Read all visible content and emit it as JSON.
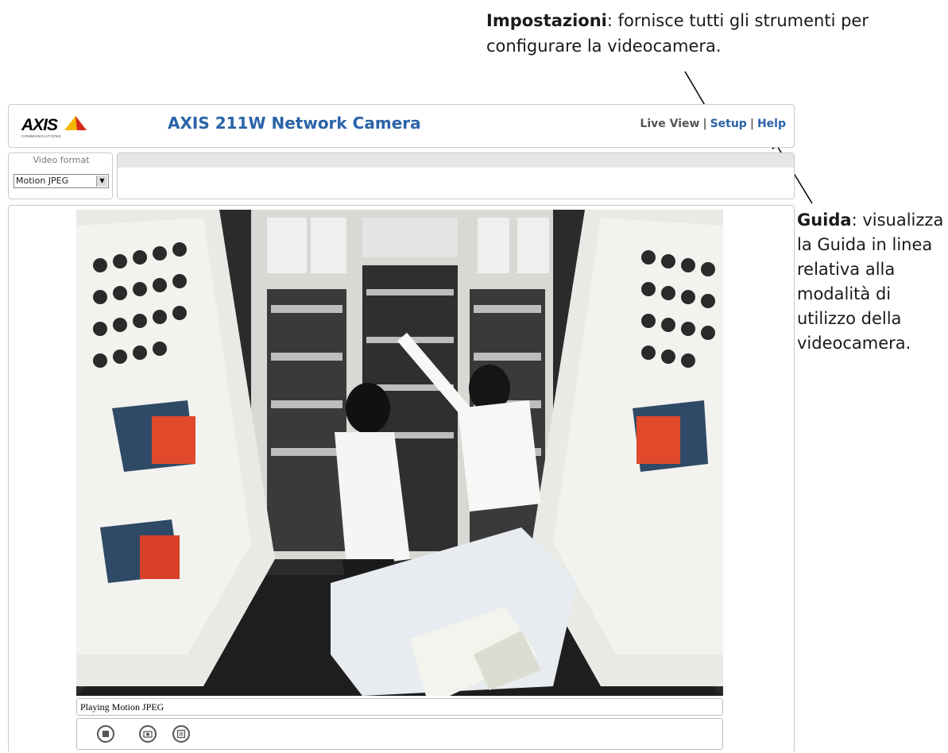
{
  "annotations": {
    "setup_term": "Impostazioni",
    "setup_desc": ": fornisce tutti gli strumenti per configurare la videocamera.",
    "help_term": "Guida",
    "help_desc": ": visualizza la Guida in linea relativa alla modalità di utilizzo della videocamera."
  },
  "header": {
    "logo_text": "AXIS",
    "logo_sub": "COMMUNICATIONS",
    "title": "AXIS 211W Network Camera",
    "nav": {
      "live_view": "Live View",
      "setup": "Setup",
      "help": "Help",
      "separator": "|"
    }
  },
  "video_format": {
    "label": "Video format",
    "selected": "Motion JPEG"
  },
  "player": {
    "status": "Playing Motion JPEG"
  },
  "colors": {
    "title_blue": "#2a63a8",
    "logo_yellow": "#f5b800",
    "logo_red": "#d42a1a"
  },
  "icons": [
    "stop-icon",
    "snapshot-icon",
    "fullscreen-icon"
  ]
}
